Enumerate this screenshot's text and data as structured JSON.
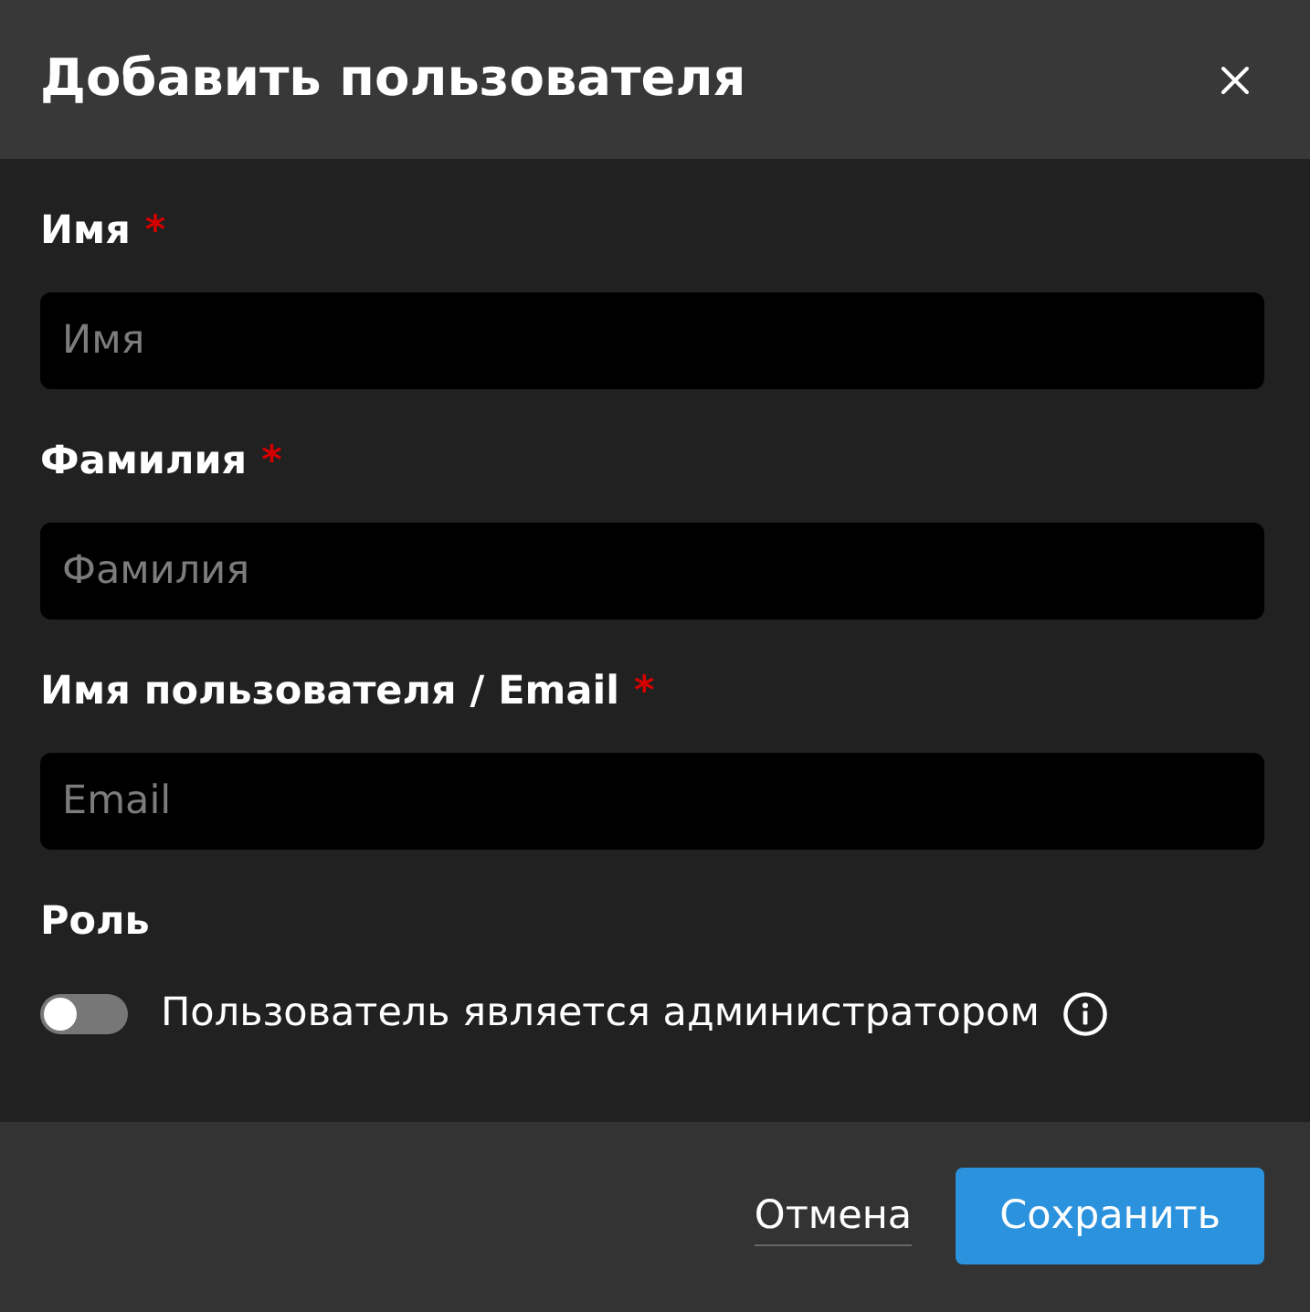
{
  "dialog": {
    "title": "Добавить пользователя"
  },
  "fields": [
    {
      "label": "Имя",
      "required_mark": "*",
      "placeholder": "Имя"
    },
    {
      "label": "Фамилия",
      "required_mark": "*",
      "placeholder": "Фамилия"
    },
    {
      "label": "Имя пользователя / Email",
      "required_mark": "*",
      "placeholder": "Email"
    }
  ],
  "role": {
    "label": "Роль",
    "toggle": {
      "label": "Пользователь является администратором",
      "on": false
    }
  },
  "buttons": [
    {
      "kind": "link",
      "label": "Отмена"
    },
    {
      "kind": "primary",
      "label": "Сохранить"
    }
  ]
}
